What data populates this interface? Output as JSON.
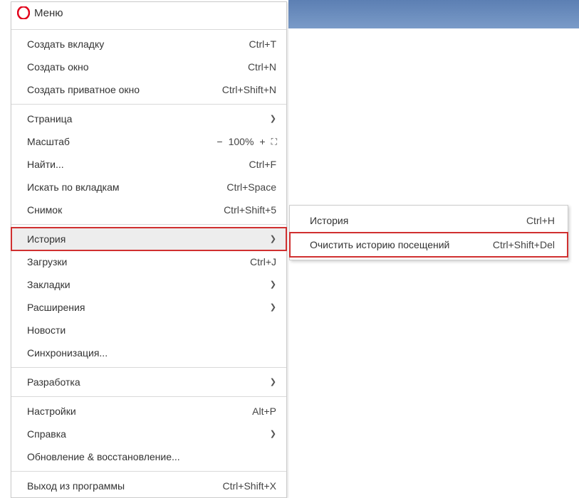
{
  "header": {
    "title": "Меню"
  },
  "menu": {
    "new_tab": {
      "label": "Создать вкладку",
      "shortcut": "Ctrl+T"
    },
    "new_window": {
      "label": "Создать окно",
      "shortcut": "Ctrl+N"
    },
    "new_private": {
      "label": "Создать приватное окно",
      "shortcut": "Ctrl+Shift+N"
    },
    "page": {
      "label": "Страница"
    },
    "zoom": {
      "label": "Масштаб",
      "minus": "−",
      "value": "100%",
      "plus": "+",
      "fullscreen": "⛶"
    },
    "find": {
      "label": "Найти...",
      "shortcut": "Ctrl+F"
    },
    "tab_search": {
      "label": "Искать по вкладкам",
      "shortcut": "Ctrl+Space"
    },
    "snapshot": {
      "label": "Снимок",
      "shortcut": "Ctrl+Shift+5"
    },
    "history": {
      "label": "История"
    },
    "downloads": {
      "label": "Загрузки",
      "shortcut": "Ctrl+J"
    },
    "bookmarks": {
      "label": "Закладки"
    },
    "extensions": {
      "label": "Расширения"
    },
    "news": {
      "label": "Новости"
    },
    "sync": {
      "label": "Синхронизация..."
    },
    "develop": {
      "label": "Разработка"
    },
    "settings": {
      "label": "Настройки",
      "shortcut": "Alt+P"
    },
    "help": {
      "label": "Справка"
    },
    "update": {
      "label": "Обновление & восстановление..."
    },
    "exit": {
      "label": "Выход из программы",
      "shortcut": "Ctrl+Shift+X"
    }
  },
  "submenu": {
    "history_open": {
      "label": "История",
      "shortcut": "Ctrl+H"
    },
    "clear_history": {
      "label": "Очистить историю посещений",
      "shortcut": "Ctrl+Shift+Del"
    }
  }
}
